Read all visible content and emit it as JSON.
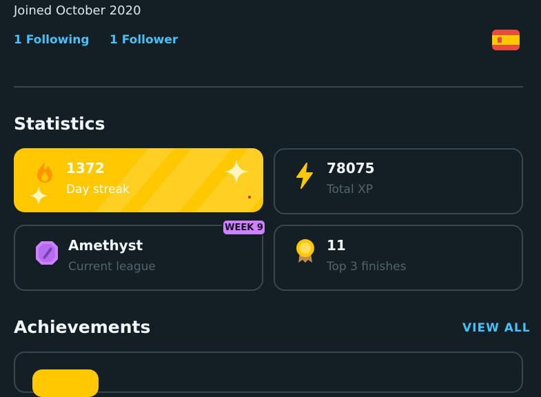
{
  "profile": {
    "joined": "Joined October 2020",
    "following": "1 Following",
    "followers": "1 Follower",
    "course_flag": "spain-flag-icon"
  },
  "statistics": {
    "title": "Statistics",
    "streak": {
      "value": "1372",
      "label": "Day streak"
    },
    "xp": {
      "value": "78075",
      "label": "Total XP"
    },
    "league": {
      "value": "Amethyst",
      "label": "Current league",
      "badge": "WEEK 9"
    },
    "top3": {
      "value": "11",
      "label": "Top 3 finishes"
    }
  },
  "achievements": {
    "title": "Achievements",
    "view_all": "VIEW ALL"
  },
  "colors": {
    "background": "#131f24",
    "accent_blue": "#49c0f8",
    "streak_yellow": "#ffc800",
    "league_purple": "#ce82ff",
    "border": "#37464f"
  }
}
